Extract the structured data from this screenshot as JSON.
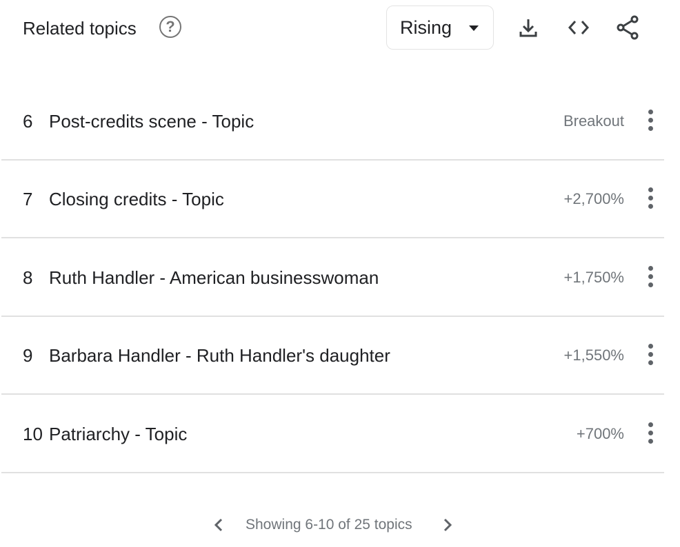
{
  "header": {
    "title": "Related topics",
    "help_icon": "question-circle-icon",
    "dropdown": {
      "selected": "Rising"
    },
    "tools": [
      "download-icon",
      "embed-code-icon",
      "share-icon"
    ]
  },
  "rows": [
    {
      "rank": "6",
      "name": "Post-credits scene - Topic",
      "value": "Breakout"
    },
    {
      "rank": "7",
      "name": "Closing credits - Topic",
      "value": "+2,700%"
    },
    {
      "rank": "8",
      "name": "Ruth Handler - American businesswoman",
      "value": "+1,750%"
    },
    {
      "rank": "9",
      "name": "Barbara Handler - Ruth Handler's daughter",
      "value": "+1,550%"
    },
    {
      "rank": "10",
      "name": "Patriarchy - Topic",
      "value": "+700%"
    }
  ],
  "pagination": {
    "text": "Showing 6-10 of 25 topics"
  }
}
